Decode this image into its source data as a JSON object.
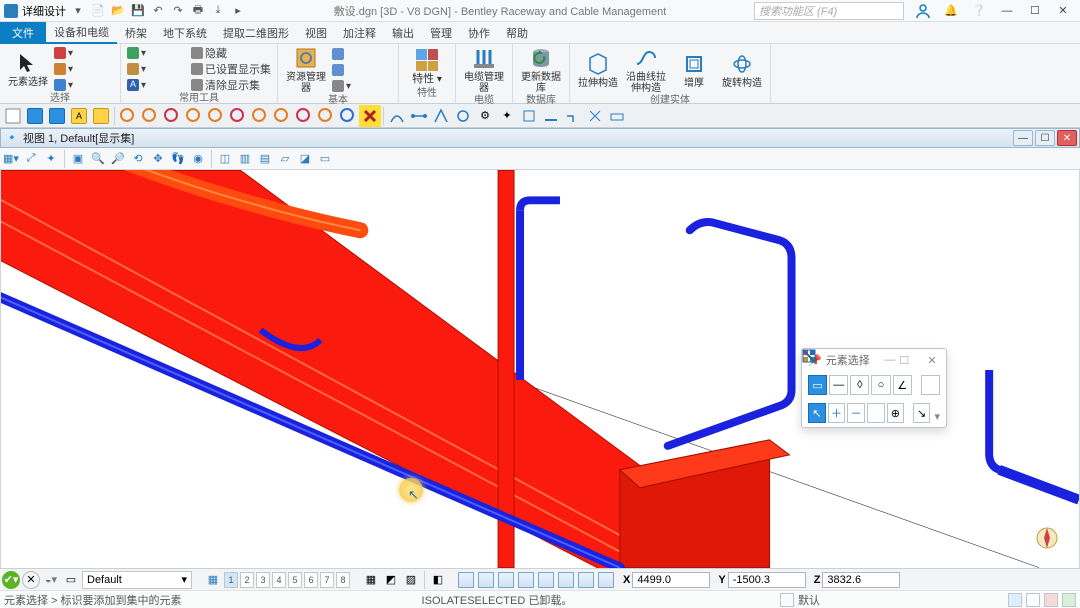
{
  "title": {
    "app": "详细设计",
    "doc": "敷设.dgn [3D - V8 DGN] - Bentley Raceway and Cable Management",
    "search_ph": "搜索功能区 (F4)"
  },
  "menu": {
    "file": "文件",
    "items": [
      "设备和电缆",
      "桥架",
      "地下系统",
      "提取二维图形",
      "视图",
      "加注释",
      "输出",
      "管理",
      "协作",
      "帮助"
    ]
  },
  "ribbon": {
    "select_big": "元素选择",
    "g1": "选择",
    "g2": "常用工具",
    "visibility": [
      "隐藏",
      "已设置显示集",
      "清除显示集"
    ],
    "res_mgr": "资源管理器",
    "g3": "基本",
    "props": "特性",
    "g4": "特性",
    "cable_mgr": "电缆管理器",
    "g5": "电缆",
    "refresh_db": "更新数据库",
    "g6": "数据库",
    "ext_build": "拉伸构造",
    "curve_ext": "沿曲线拉伸构造",
    "thick": "增厚",
    "rot_build": "旋转构造",
    "g7": "创建实体"
  },
  "view": {
    "header": "视图 1, Default[显示集]"
  },
  "palette": {
    "title": "元素选择"
  },
  "coords": {
    "x": "4499.0",
    "y": "-1500.3",
    "z": "3832.6",
    "level": "Default"
  },
  "status": {
    "breadcrumb": "元素选择 > 标识要添加到集中的元素",
    "cmd": "ISOLATESELECTED 已卸载。",
    "mode": "默认"
  },
  "view_numbers": [
    "1",
    "2",
    "3",
    "4",
    "5",
    "6",
    "7",
    "8"
  ]
}
